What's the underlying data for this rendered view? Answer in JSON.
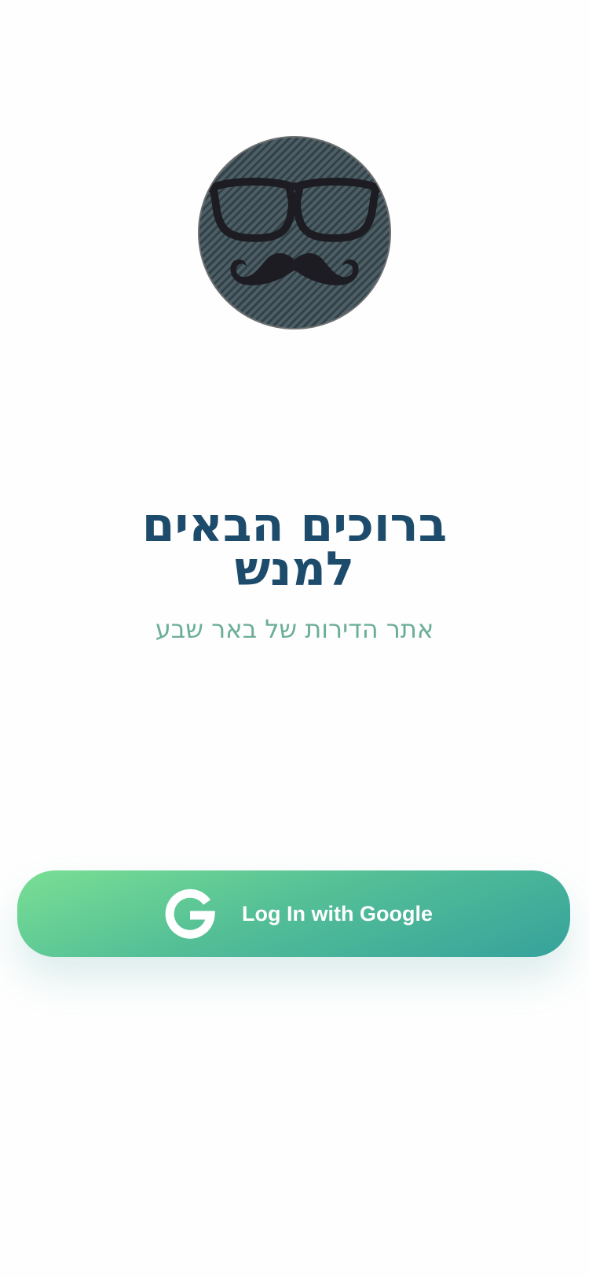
{
  "logo": {
    "icon": "glasses-mustache-icon",
    "background_color": "#4d5f66"
  },
  "welcome": {
    "title_line1": "ברוכים הבאים",
    "title_line2": "למנש",
    "subtitle": "אתר הדירות של באר שבע",
    "title_color": "#1d4b6b",
    "subtitle_color": "#6bae98"
  },
  "login": {
    "label": "Log In with Google",
    "icon": "google-g-icon",
    "gradient_start": "#79df94",
    "gradient_end": "#36a29c"
  }
}
